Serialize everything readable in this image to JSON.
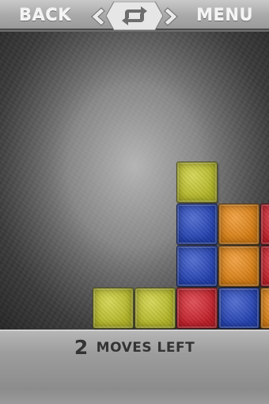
{
  "header": {
    "back_label": "BACK",
    "menu_label": "MENU",
    "prev_icon": "chevron-left-icon",
    "next_icon": "chevron-right-icon",
    "restart_icon": "restart-arrows-icon"
  },
  "status": {
    "moves_count": "2",
    "moves_label": "MOVES LEFT"
  },
  "colors": {
    "yellow": "#c9cc2a",
    "blue": "#2447c4",
    "orange": "#ee8a12",
    "red": "#d8202a"
  },
  "board": {
    "columns": 6,
    "rows": 4,
    "cells": [
      [
        "",
        "",
        "",
        "yellow",
        "",
        ""
      ],
      [
        "",
        "",
        "",
        "blue",
        "orange",
        "red"
      ],
      [
        "",
        "",
        "",
        "blue",
        "orange",
        "red"
      ],
      [
        "",
        "yellow",
        "yellow",
        "red",
        "blue",
        "orange"
      ]
    ]
  }
}
